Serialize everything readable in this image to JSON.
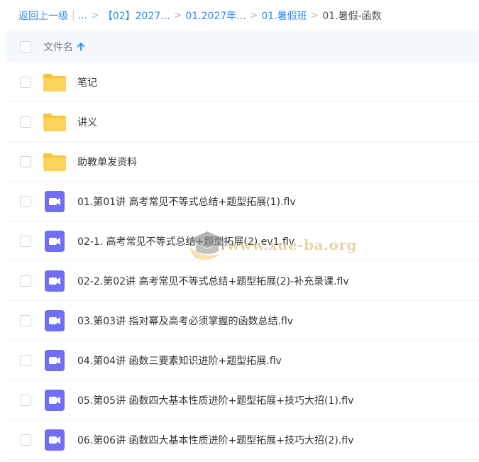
{
  "breadcrumb": {
    "back_label": "返回上一级",
    "pipe": "|",
    "ellipsis": "...",
    "sep": ">",
    "crumbs": [
      "【02】2027...",
      "01.2027年...",
      "01.暑假班"
    ],
    "current": "01.暑假-函数"
  },
  "header": {
    "column_title": "文件名",
    "sort_icon": "arrow-up-icon"
  },
  "files": [
    {
      "name": "笔记",
      "type": "folder-icon"
    },
    {
      "name": "讲义",
      "type": "folder-icon"
    },
    {
      "name": "助教单发资料",
      "type": "folder-icon"
    },
    {
      "name": "01.第01讲 高考常见不等式总结+题型拓展(1).flv",
      "type": "video-icon"
    },
    {
      "name": "02-1. 高考常见不等式总结+题型拓展(2).ev1.flv",
      "type": "video-icon"
    },
    {
      "name": "02-2.第02讲 高考常见不等式总结+题型拓展(2)-补充录课.flv",
      "type": "video-icon"
    },
    {
      "name": "03.第03讲 指对幂及高考必须掌握的函数总结.flv",
      "type": "video-icon"
    },
    {
      "name": "04.第04讲 函数三要素知识进阶+题型拓展.flv",
      "type": "video-icon"
    },
    {
      "name": "05.第05讲 函数四大基本性质进阶+题型拓展+技巧大招(1).flv",
      "type": "video-icon"
    },
    {
      "name": "06.第06讲 函数四大基本性质进阶+题型拓展+技巧大招(2).flv",
      "type": "video-icon"
    }
  ],
  "watermark": {
    "text": "www.xue-ba.org",
    "icon": "graduation-cap-icon"
  },
  "colors": {
    "link": "#2d8cf0",
    "folder": "#f8c53a",
    "video": "#6f6ef5",
    "header_bg": "#f4f8fc"
  }
}
